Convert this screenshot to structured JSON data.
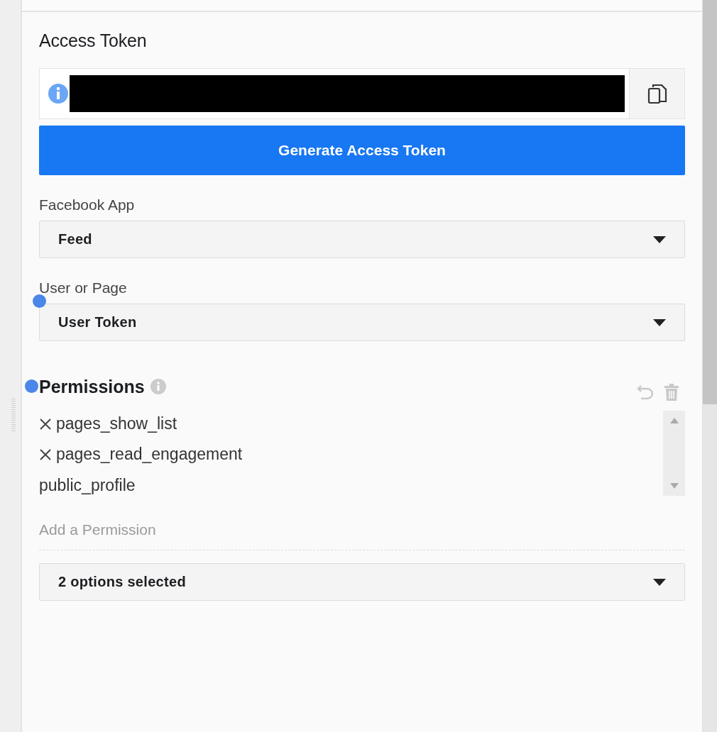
{
  "access_token": {
    "title": "Access Token",
    "redacted": true,
    "generate_button": "Generate Access Token"
  },
  "selects": [
    {
      "label": "Facebook App",
      "value": "Feed"
    },
    {
      "label": "User or Page",
      "value": "User Token"
    }
  ],
  "permissions": {
    "title": "Permissions",
    "items": [
      {
        "name": "pages_show_list",
        "removable": true
      },
      {
        "name": "pages_read_engagement",
        "removable": true
      },
      {
        "name": "public_profile",
        "removable": false
      }
    ],
    "placeholder": "Add a Permission",
    "summary": "2 options selected"
  }
}
